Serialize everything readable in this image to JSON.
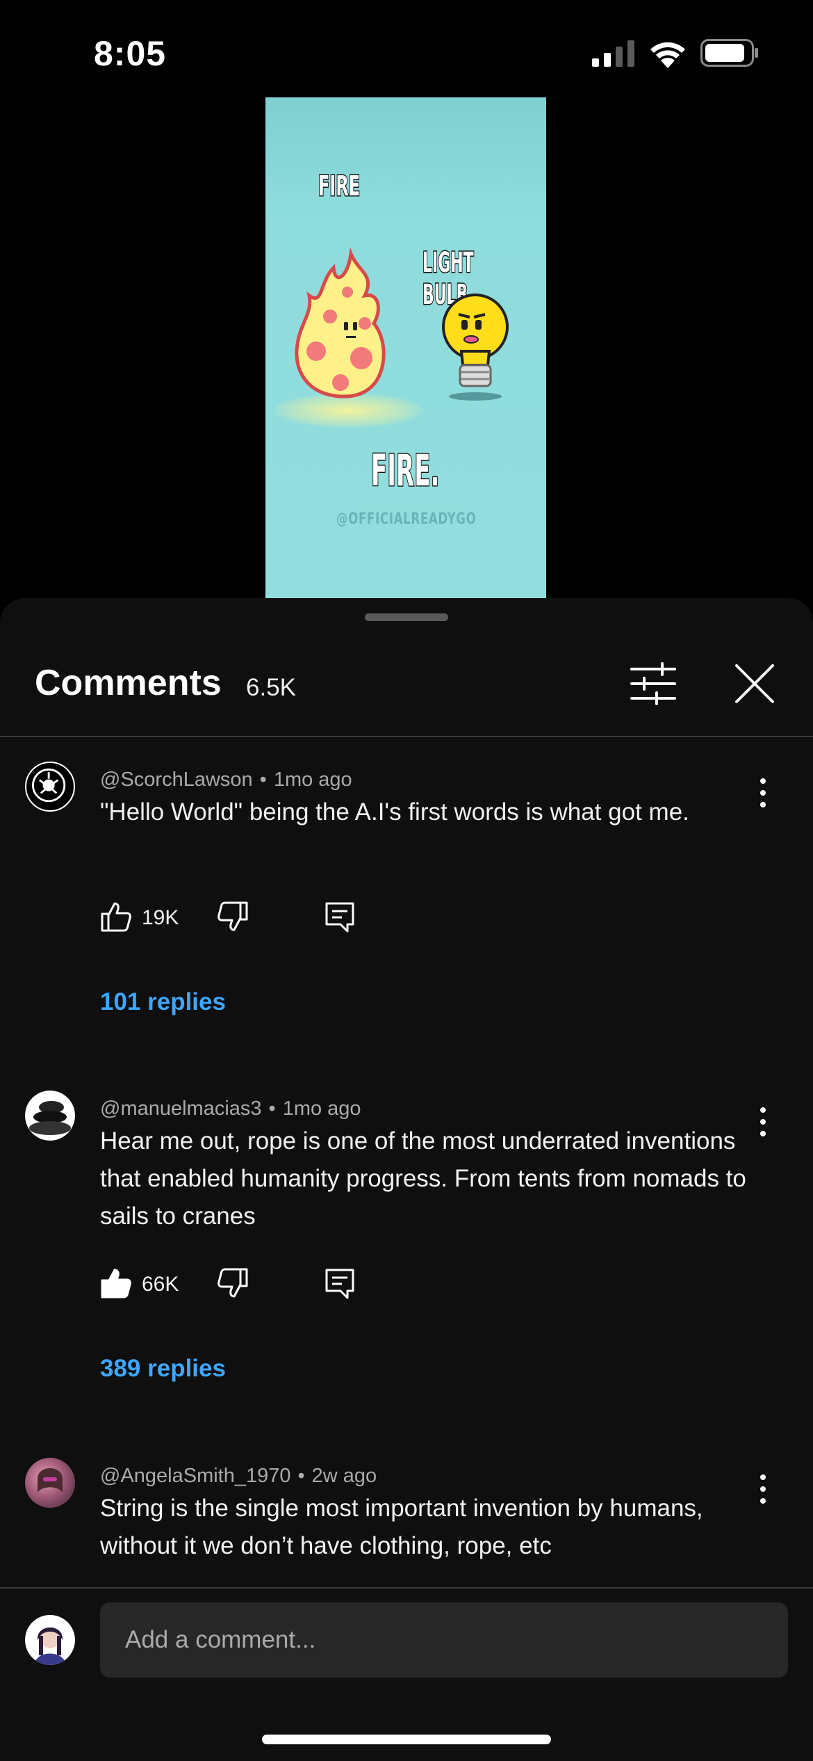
{
  "status_bar": {
    "time": "8:05"
  },
  "video": {
    "label_fire": "FIRE",
    "label_bulb": "LIGHT BULB",
    "caption": "FIRE.",
    "handle": "@OFFICIALREADYGO"
  },
  "header": {
    "title": "Comments",
    "count": "6.5K"
  },
  "comments": [
    {
      "author": "@ScorchLawson",
      "time": "1mo ago",
      "text": "\"Hello World\" being the A.I's first words is what got me.",
      "likes": "19K",
      "liked": false,
      "replies": "101 replies"
    },
    {
      "author": "@manuelmacias3",
      "time": "1mo ago",
      "text": "Hear me out, rope is one of the most underrated inventions that enabled humanity progress. From tents from nomads to sails to cranes",
      "likes": "66K",
      "liked": true,
      "replies": "389 replies"
    },
    {
      "author": "@AngelaSmith_1970",
      "time": "2w ago",
      "text": "String is the single most important invention by humans, without it we don’t have clothing, rope, etc"
    }
  ],
  "composer": {
    "placeholder": "Add a comment..."
  },
  "colors": {
    "background": "#0f0f0f",
    "link": "#3ea6ff",
    "secondary_text": "#aaaaaa",
    "input_bg": "#272727"
  }
}
